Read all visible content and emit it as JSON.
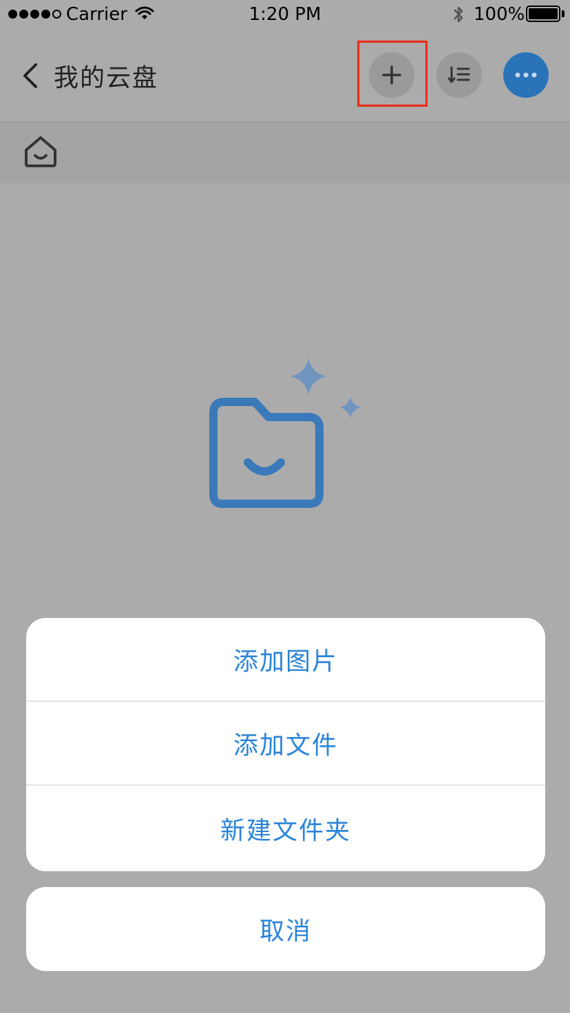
{
  "status_bar": {
    "carrier": "Carrier",
    "time": "1:20 PM",
    "battery": "100%"
  },
  "nav": {
    "title": "我的云盘",
    "back_icon": "chevron-left-icon",
    "add_icon": "plus-icon",
    "sort_icon": "sort-list-icon",
    "more_icon": "more-dots-icon",
    "accent_color": "#2a73b9"
  },
  "breadcrumb": {
    "home_icon": "home-icon"
  },
  "empty_state": {
    "icon": "folder-smile-icon"
  },
  "action_sheet": {
    "items": [
      {
        "label": "添加图片"
      },
      {
        "label": "添加文件"
      },
      {
        "label": "新建文件夹"
      }
    ],
    "cancel_label": "取消",
    "label_color": "#2b84d8"
  },
  "highlight_color": "#ee2a12"
}
